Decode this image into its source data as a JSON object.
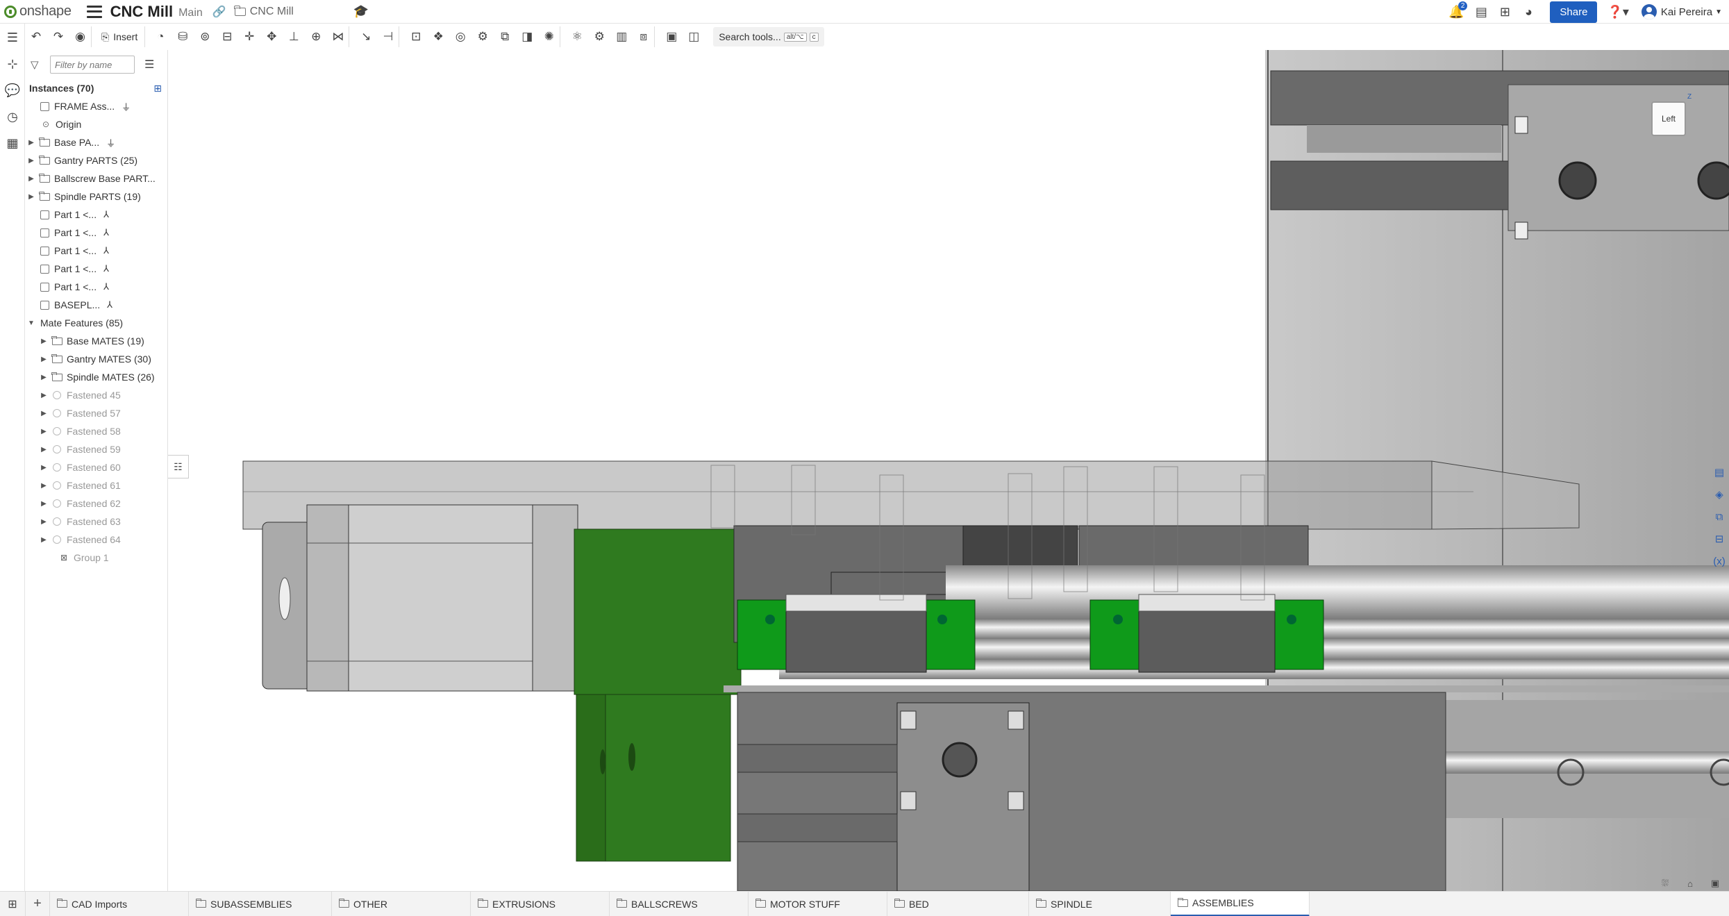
{
  "app": {
    "logo_text": "onshape",
    "doc_title": "CNC Mill",
    "workspace": "Main",
    "folder": "CNC Mill",
    "notifications_count": "2",
    "share_label": "Share",
    "user_name": "Kai Pereira"
  },
  "toolbar": {
    "insert_label": "Insert",
    "search_label": "Search tools...",
    "search_kbd1": "alt/⌥",
    "search_kbd2": "c"
  },
  "panel": {
    "filter_placeholder": "Filter by name",
    "instances_header": "Instances (70)",
    "instances": [
      {
        "label": "FRAME Ass...",
        "icon": "part",
        "badge": "fixed"
      },
      {
        "label": "Origin",
        "icon": "origin",
        "badge": ""
      },
      {
        "label": "Base PA...",
        "icon": "folder",
        "badge": "fixed",
        "expand": true
      },
      {
        "label": "Gantry PARTS (25)",
        "icon": "folder",
        "expand": true
      },
      {
        "label": "Ballscrew Base PART...",
        "icon": "folder",
        "expand": true
      },
      {
        "label": "Spindle PARTS (19)",
        "icon": "folder",
        "expand": true
      },
      {
        "label": "Part 1 <...",
        "icon": "part",
        "badge": "mate"
      },
      {
        "label": "Part 1 <...",
        "icon": "part",
        "badge": "mate"
      },
      {
        "label": "Part 1 <...",
        "icon": "part",
        "badge": "mate"
      },
      {
        "label": "Part 1 <...",
        "icon": "part",
        "badge": "mate"
      },
      {
        "label": "Part 1 <...",
        "icon": "part",
        "badge": "mate"
      },
      {
        "label": "BASEPL...",
        "icon": "part",
        "badge": "mate"
      }
    ],
    "mates_header": "Mate Features (85)",
    "mates": [
      {
        "label": "Base MATES (19)",
        "icon": "folder",
        "muted": false
      },
      {
        "label": "Gantry MATES (30)",
        "icon": "folder",
        "muted": false
      },
      {
        "label": "Spindle MATES (26)",
        "icon": "folder",
        "muted": false
      },
      {
        "label": "Fastened 45",
        "icon": "mate",
        "muted": true
      },
      {
        "label": "Fastened 57",
        "icon": "mate",
        "muted": true
      },
      {
        "label": "Fastened 58",
        "icon": "mate",
        "muted": true
      },
      {
        "label": "Fastened 59",
        "icon": "mate",
        "muted": true
      },
      {
        "label": "Fastened 60",
        "icon": "mate",
        "muted": true
      },
      {
        "label": "Fastened 61",
        "icon": "mate",
        "muted": true
      },
      {
        "label": "Fastened 62",
        "icon": "mate",
        "muted": true
      },
      {
        "label": "Fastened 63",
        "icon": "mate",
        "muted": true
      },
      {
        "label": "Fastened 64",
        "icon": "mate",
        "muted": true
      }
    ],
    "group_label": "Group 1"
  },
  "viewcube": {
    "face": "Left",
    "axis_z": "Z"
  },
  "tabs": [
    {
      "label": "CAD Imports",
      "active": false
    },
    {
      "label": "SUBASSEMBLIES",
      "active": false
    },
    {
      "label": "OTHER",
      "active": false
    },
    {
      "label": "EXTRUSIONS",
      "active": false
    },
    {
      "label": "BALLSCREWS",
      "active": false
    },
    {
      "label": "MOTOR STUFF",
      "active": false
    },
    {
      "label": "BED",
      "active": false
    },
    {
      "label": "SPINDLE",
      "active": false
    },
    {
      "label": "ASSEMBLIES",
      "active": true
    }
  ],
  "colors": {
    "accent": "#2a5db0",
    "part_green": "#2f7a1f",
    "rail_green": "#0f9a1a",
    "metal": "#8a8a8a"
  }
}
